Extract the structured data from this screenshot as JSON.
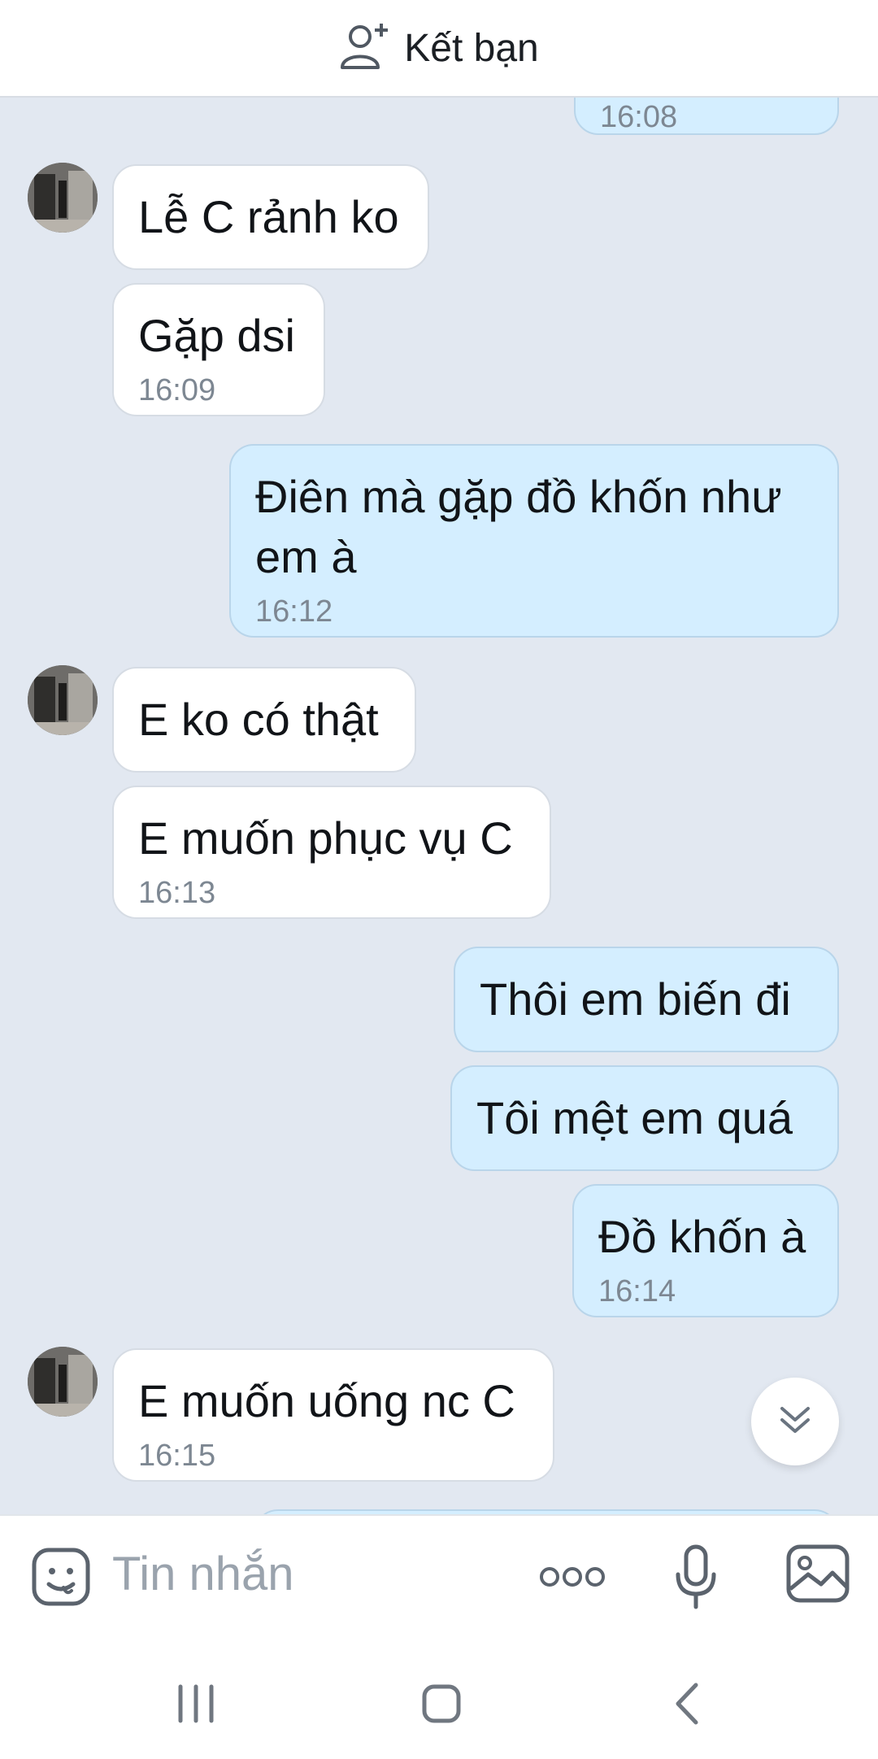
{
  "header": {
    "add_friend_label": "Kết bạn",
    "icon": "add-friend-icon"
  },
  "messages": [
    {
      "dir": "out",
      "text": "",
      "time": "16:08"
    },
    {
      "dir": "in",
      "text": "Lễ C rảnh ko",
      "time": ""
    },
    {
      "dir": "in",
      "text": "Gặp dsi",
      "time": "16:09"
    },
    {
      "dir": "out",
      "text": "Điên mà gặp đồ khốn như em à",
      "time": "16:12"
    },
    {
      "dir": "in",
      "text": "E ko có thật",
      "time": ""
    },
    {
      "dir": "in",
      "text": "E muốn phục vụ C",
      "time": "16:13"
    },
    {
      "dir": "out",
      "text": "Thôi em biến đi",
      "time": ""
    },
    {
      "dir": "out",
      "text": "Tôi mệt em quá",
      "time": ""
    },
    {
      "dir": "out",
      "text": "Đồ khốn à",
      "time": "16:14"
    },
    {
      "dir": "in",
      "text": "E muốn uống nc C",
      "time": "16:15"
    }
  ],
  "composer": {
    "placeholder": "Tin nhắn",
    "icons": [
      "emoji-icon",
      "more-icon",
      "microphone-icon",
      "image-icon"
    ]
  },
  "navigation": {
    "icons": [
      "recent-apps-icon",
      "home-icon",
      "back-icon"
    ]
  },
  "colors": {
    "chat_background": "#e2e8f1",
    "incoming_bubble": "#ffffff",
    "outgoing_bubble": "#d4eeff",
    "timestamp": "#7d8792"
  }
}
